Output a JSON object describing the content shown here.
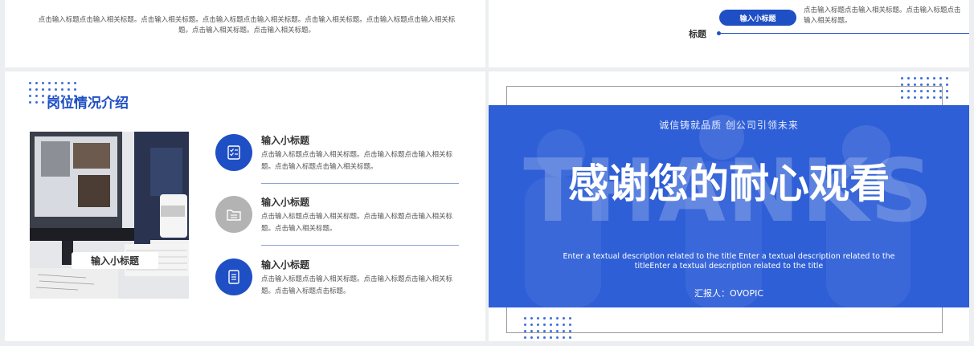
{
  "top_left": {
    "text": "点击输入标题点击输入相关标题。点击输入相关标题。点击输入标题点击输入相关标题。点击输入相关标题。点击输入标题点击输入相关标题。点击输入相关标题。点击输入相关标题。"
  },
  "top_right": {
    "pill_label": "输入小标题",
    "text": "点击输入标题点击输入相关标题。点击输入标题点击输入相关标题。",
    "axis_label": "标题"
  },
  "bottom_left": {
    "section_title": "岗位情况介绍",
    "photo_caption": "输入小标题",
    "items": [
      {
        "icon": "checklist-icon",
        "title": "输入小标题",
        "desc": "点击输入标题点击输入相关标题。点击输入标题点击输入相关标题。点击输入标题点击输入相关标题。"
      },
      {
        "icon": "folder-list-icon",
        "title": "输入小标题",
        "desc": "点击输入标题点击输入相关标题。点击输入标题点击输入相关标题。点击输入相关标题。"
      },
      {
        "icon": "document-icon",
        "title": "输入小标题",
        "desc": "点击输入标题点击输入相关标题。点击输入标题点击输入相关标题。点击输入标题点击标题。"
      }
    ],
    "colors": {
      "primary": "#1f4fc4",
      "gray": "#b3b3b3"
    }
  },
  "thanks_slide": {
    "slogan": "诚信铸就品质 创公司引领未来",
    "watermark": "THANKS",
    "title": "感谢您的耐心观看",
    "desc": "Enter a textual description related to the title Enter a textual description related to the titleEnter a textual description related to the title",
    "reporter": "汇报人：OVOPIC",
    "colors": {
      "banner": "#2f5fd6"
    }
  }
}
